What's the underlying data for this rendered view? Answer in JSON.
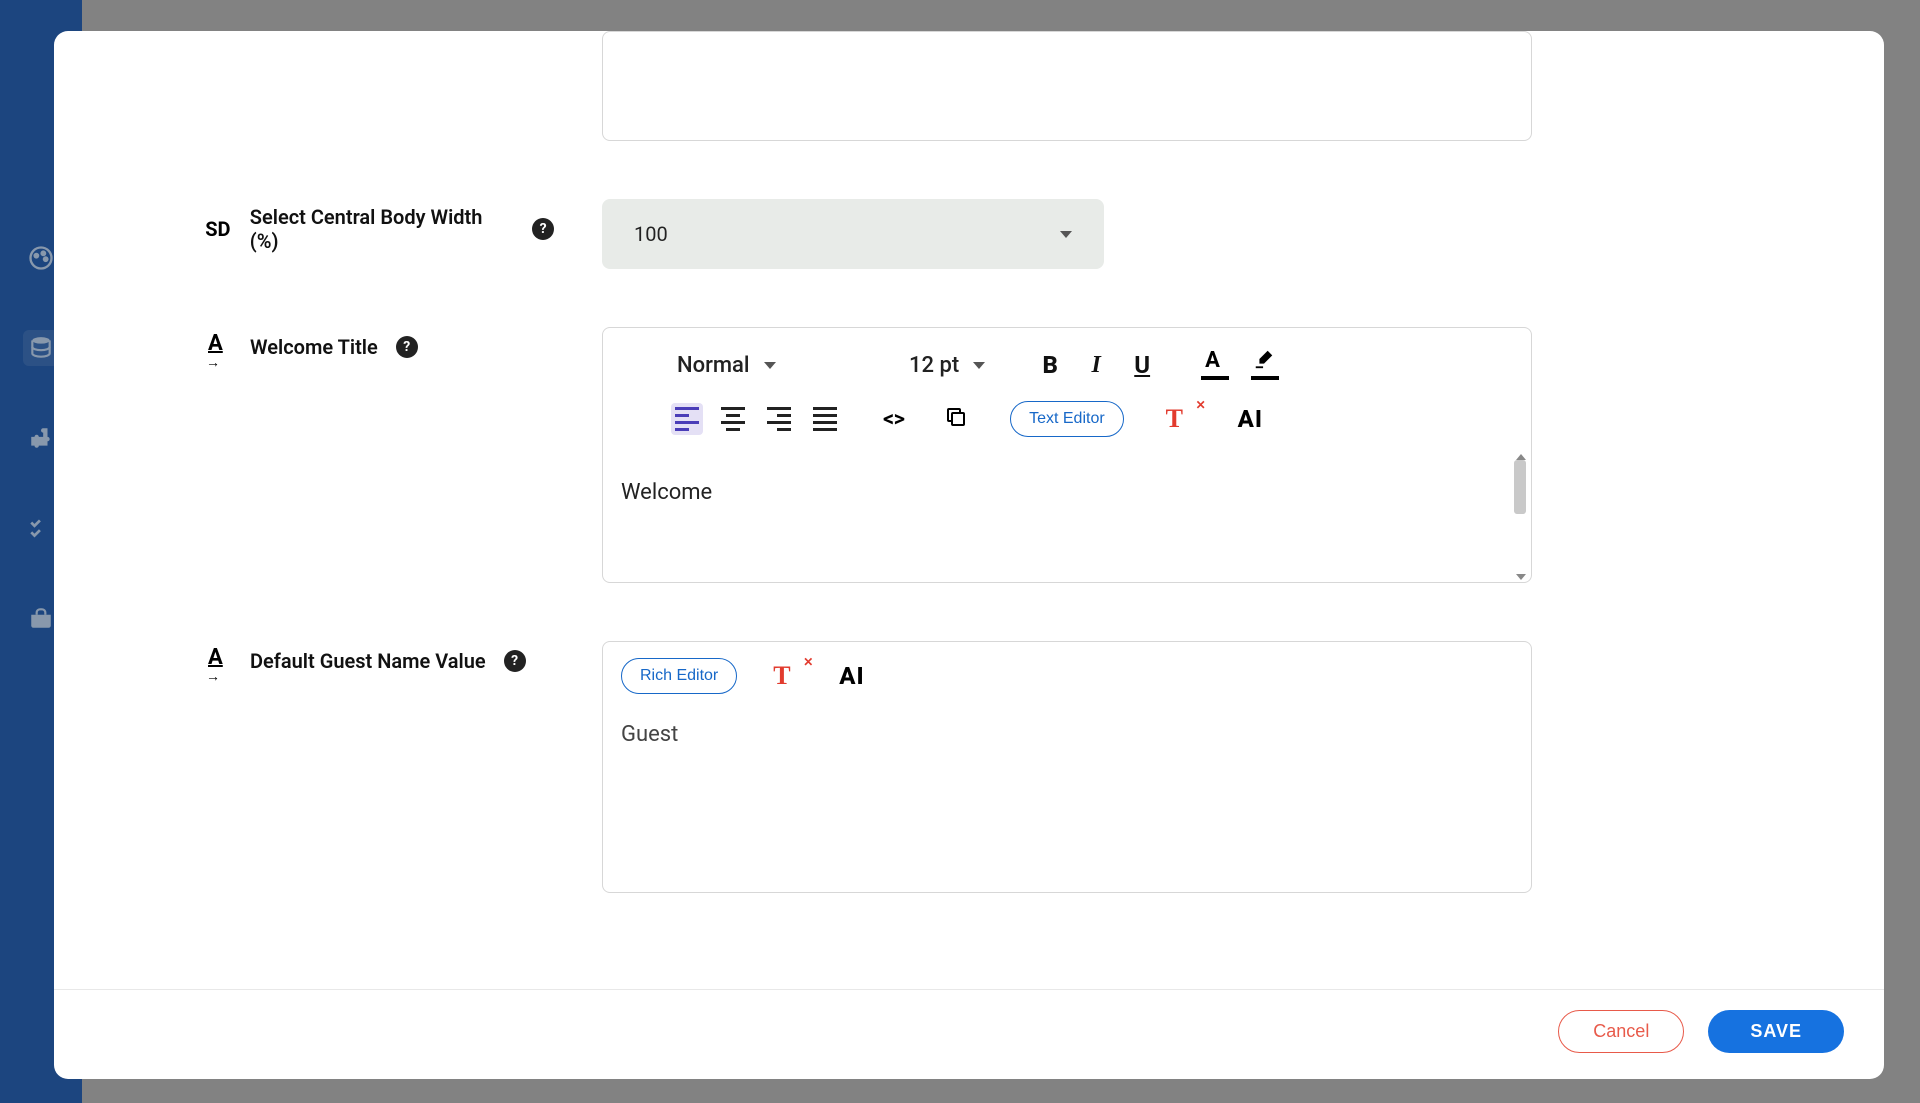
{
  "sidebar": {
    "icons": [
      "palette",
      "database",
      "puzzle",
      "check",
      "toolbox"
    ]
  },
  "fields": {
    "central_body_width": {
      "label": "Select Central Body Width (%)",
      "lead_tag": "SD",
      "value": "100"
    },
    "welcome_title": {
      "label": "Welcome Title",
      "content": "Welcome",
      "toolbar": {
        "style_label": "Normal",
        "font_size_label": "12 pt",
        "text_editor_btn": "Text Editor",
        "ai_label": "AI"
      }
    },
    "default_guest_name": {
      "label": "Default Guest Name Value",
      "content": "Guest",
      "toolbar": {
        "rich_editor_btn": "Rich Editor",
        "ai_label": "AI"
      }
    }
  },
  "footer": {
    "cancel_label": "Cancel",
    "save_label": "SAVE"
  }
}
